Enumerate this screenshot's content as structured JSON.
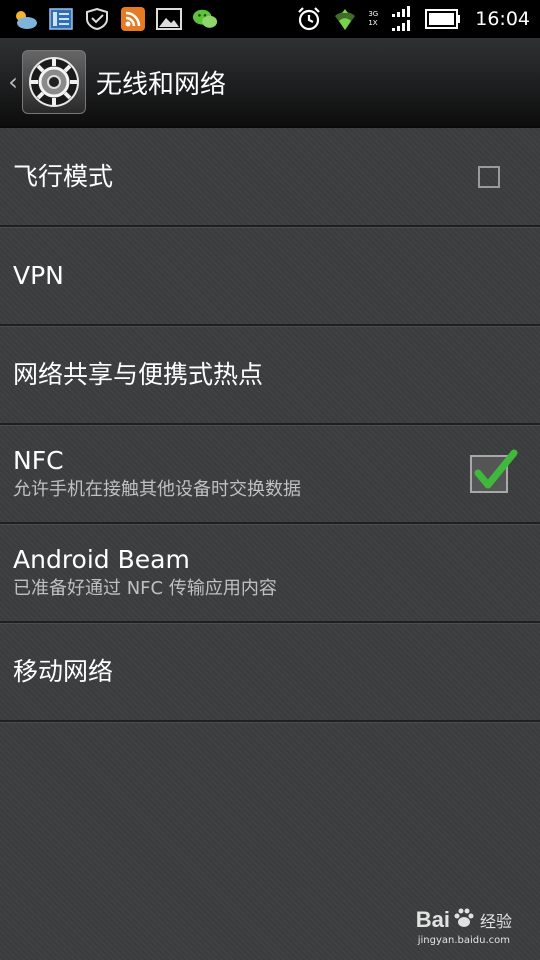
{
  "status_bar": {
    "time": "16:04",
    "network_top": "3G",
    "network_bottom": "1X",
    "icons": [
      "weather-icon",
      "news-icon",
      "shield-message-icon",
      "rss-icon",
      "gallery-icon",
      "wechat-icon",
      "alarm-icon",
      "wifi-icon",
      "signal-icon",
      "battery-icon"
    ]
  },
  "title_bar": {
    "back_glyph": "‹",
    "title": "无线和网络"
  },
  "items": [
    {
      "title": "飞行模式",
      "summary": "",
      "checked": false
    },
    {
      "title": "VPN",
      "summary": ""
    },
    {
      "title": "网络共享与便携式热点",
      "summary": ""
    },
    {
      "title": "NFC",
      "summary": "允许手机在接触其他设备时交换数据",
      "checked": true
    },
    {
      "title": "Android Beam",
      "summary": "已准备好通过 NFC 传输应用内容"
    },
    {
      "title": "移动网络",
      "summary": ""
    }
  ],
  "watermark": {
    "brand_left": "Bai",
    "brand_right": "经验",
    "url": "jingyan.baidu.com"
  },
  "colors": {
    "background": "#3b3d3e",
    "check_green": "#3fb93c",
    "title_bar_dark": "#0d0d0d"
  }
}
